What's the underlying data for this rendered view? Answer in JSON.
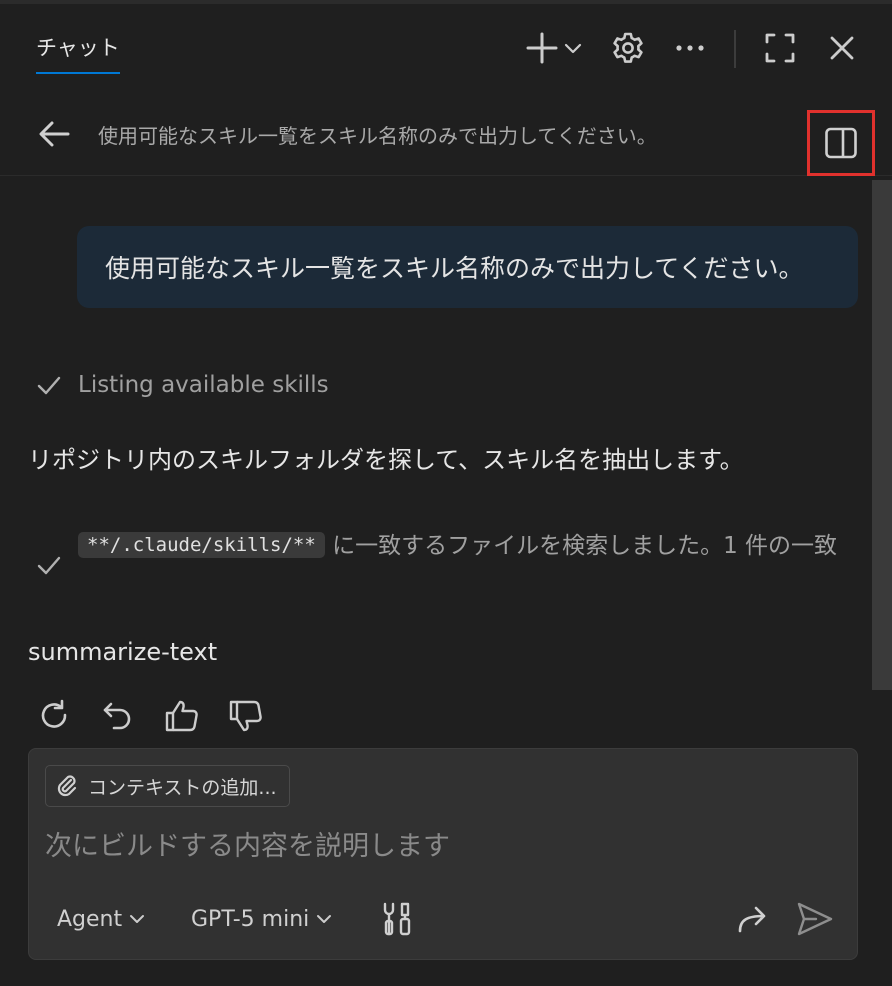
{
  "header": {
    "tab_label": "チャット"
  },
  "session": {
    "title": "使用可能なスキル一覧をスキル名称のみで出力してください。"
  },
  "conversation": {
    "user_message": "使用可能なスキル一覧をスキル名称のみで出力してください。",
    "progress_step": "Listing available skills",
    "assistant_text": "リポジトリ内のスキルフォルダを探して、スキル名を抽出します。",
    "search_pattern": "**/.claude/skills/**",
    "search_result_text": " に一致するファイルを検索しました。1 件の一致",
    "result": "summarize-text"
  },
  "input": {
    "context_button_label": "コンテキストの追加...",
    "placeholder": "次にビルドする内容を説明します",
    "mode_label": "Agent",
    "model_label": "GPT-5 mini"
  },
  "colors": {
    "accent": "#0078d4",
    "highlight_border": "#e0312d",
    "user_bubble": "#1c2a38"
  }
}
